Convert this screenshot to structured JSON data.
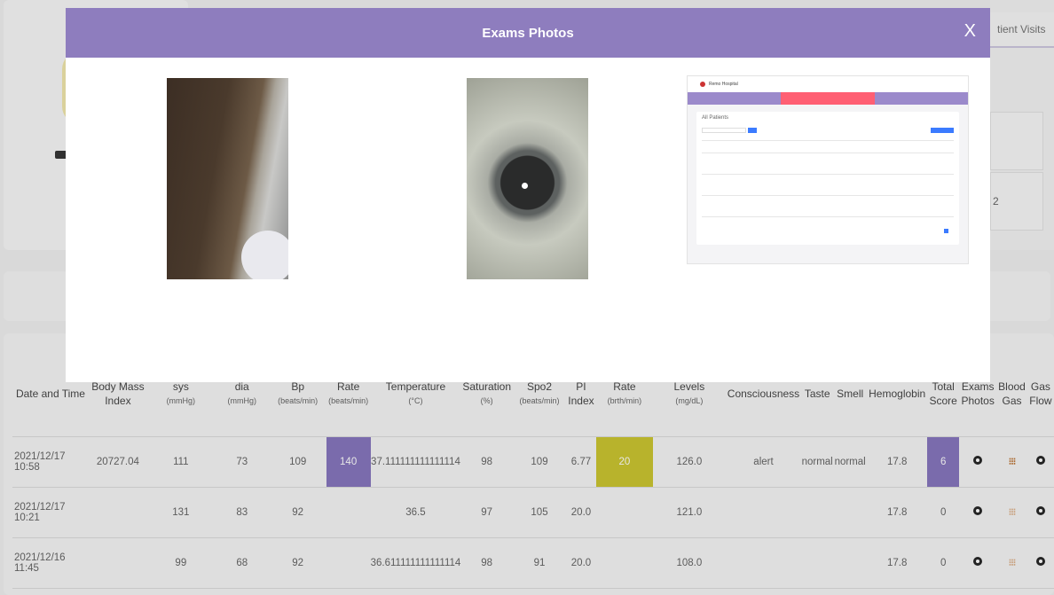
{
  "background": {
    "visits_tab": "tient Visits",
    "side_value": "2"
  },
  "table": {
    "headers": [
      {
        "title": "Date and Time",
        "unit": ""
      },
      {
        "title": "Body Mass Index",
        "unit": ""
      },
      {
        "title": "sys",
        "unit": "(mmHg)"
      },
      {
        "title": "dia",
        "unit": "(mmHg)"
      },
      {
        "title": "Bp",
        "unit": "(beats/min)"
      },
      {
        "title": "Rate",
        "unit": "(beats/min)"
      },
      {
        "title": "Temperature",
        "unit": "(°C)"
      },
      {
        "title": "Saturation",
        "unit": "(%)"
      },
      {
        "title": "Spo2",
        "unit": "(beats/min)"
      },
      {
        "title": "PI Index",
        "unit": ""
      },
      {
        "title": "Rate",
        "unit": "(brth/min)"
      },
      {
        "title": "Levels",
        "unit": "(mg/dL)"
      },
      {
        "title": "Consciousness",
        "unit": ""
      },
      {
        "title": "Taste",
        "unit": ""
      },
      {
        "title": "Smell",
        "unit": ""
      },
      {
        "title": "Hemoglobin",
        "unit": ""
      },
      {
        "title": "Total Score",
        "unit": ""
      },
      {
        "title": "Exams Photos",
        "unit": ""
      },
      {
        "title": "Blood Gas",
        "unit": ""
      },
      {
        "title": "Gas Flow",
        "unit": ""
      }
    ],
    "rows": [
      {
        "datetime": "2021/12/17 10:58",
        "bmi": "20727.04",
        "sys": "111",
        "dia": "73",
        "bp": "109",
        "rate": "140",
        "temp": "37.111111111111114",
        "saturation": "98",
        "spo2": "109",
        "pi": "6.77",
        "resp_rate": "20",
        "levels": "126.0",
        "consciousness": "alert",
        "taste": "normal",
        "smell": "normal",
        "hemoglobin": "17.8",
        "score": "6"
      },
      {
        "datetime": "2021/12/17 10:21",
        "bmi": "",
        "sys": "131",
        "dia": "83",
        "bp": "92",
        "rate": "",
        "temp": "36.5",
        "saturation": "97",
        "spo2": "105",
        "pi": "20.0",
        "resp_rate": "",
        "levels": "121.0",
        "consciousness": "",
        "taste": "",
        "smell": "",
        "hemoglobin": "17.8",
        "score": "0"
      },
      {
        "datetime": "2021/12/16 11:45",
        "bmi": "",
        "sys": "99",
        "dia": "68",
        "bp": "92",
        "rate": "",
        "temp": "36.611111111111114",
        "saturation": "98",
        "spo2": "91",
        "pi": "20.0",
        "resp_rate": "",
        "levels": "108.0",
        "consciousness": "",
        "taste": "",
        "smell": "",
        "hemoglobin": "17.8",
        "score": "0"
      }
    ]
  },
  "modal": {
    "title": "Exams Photos",
    "close_label": "X",
    "screenshot_app_name": "Remo Hospital",
    "screenshot_heading": "All Patients"
  },
  "colors": {
    "modal_header": "#8e7dbe",
    "highlight_purple": "#7b68b8",
    "highlight_olive": "#c6c01c"
  }
}
